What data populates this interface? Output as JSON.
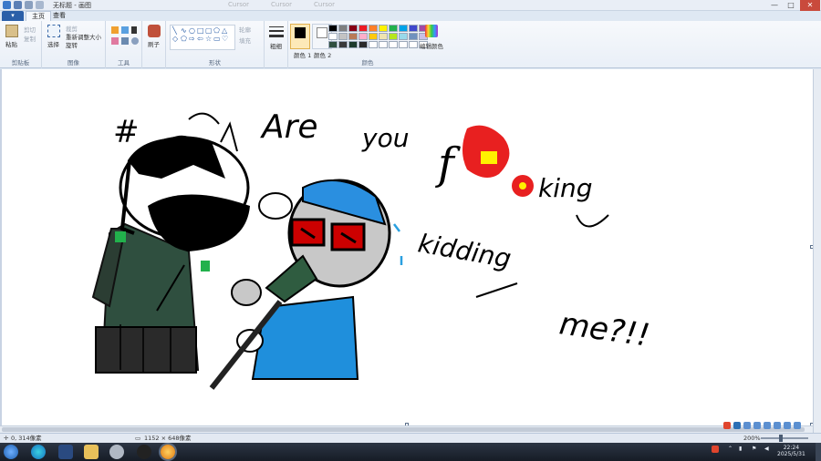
{
  "window": {
    "title": "无标题 - 画图",
    "controls": {
      "minimize": "—",
      "maximize": "□",
      "close": "✕"
    },
    "ghost_tabs": [
      "Cursor",
      "Cursor",
      "Cursor"
    ]
  },
  "ribbon": {
    "file_tab": "▾",
    "tabs": [
      "主页",
      "查看"
    ],
    "clipboard": {
      "paste": "粘贴",
      "cut": "剪切",
      "copy": "复制",
      "label": "剪贴板"
    },
    "image": {
      "select": "选择",
      "crop": "裁剪",
      "resize": "重新调整大小",
      "rotate": "旋转",
      "label": "图像"
    },
    "tools": {
      "label": "工具"
    },
    "brush": {
      "label": "刷子"
    },
    "shapes": {
      "outline": "轮廓",
      "fill": "填充",
      "label": "形状"
    },
    "size": {
      "label": "粗细"
    },
    "colors": {
      "color1": "颜色 1",
      "color2": "颜色 2",
      "edit": "编辑颜色",
      "label": "颜色",
      "swatches": [
        "#000000",
        "#7f7f7f",
        "#880015",
        "#ed1c24",
        "#ff7f27",
        "#fff200",
        "#22b14c",
        "#00a2e8",
        "#3f48cc",
        "#a349a4",
        "#ffffff",
        "#c3c3c3",
        "#b97a57",
        "#ffaec9",
        "#ffc90e",
        "#efe4b0",
        "#b5e61d",
        "#99d9ea",
        "#7092be",
        "#c8bfe7",
        "#2f4f3f",
        "#3a3a3a",
        "#1d3b2c",
        "#2a2a2a",
        "#ffffff",
        "#ffffff",
        "#ffffff",
        "#ffffff",
        "#ffffff",
        "#ffffff"
      ]
    }
  },
  "canvas_text": {
    "t1": "Are",
    "t2": "you",
    "t3": "f",
    "t4": "king",
    "t5": "kidding",
    "t6": "me?!!",
    "hash": "#"
  },
  "status": {
    "cursor": "0, 314像素",
    "size": "1152 × 648像素",
    "zoom": "200%"
  },
  "taskbar": {
    "time": "22:24",
    "date": "2025/5/31"
  }
}
